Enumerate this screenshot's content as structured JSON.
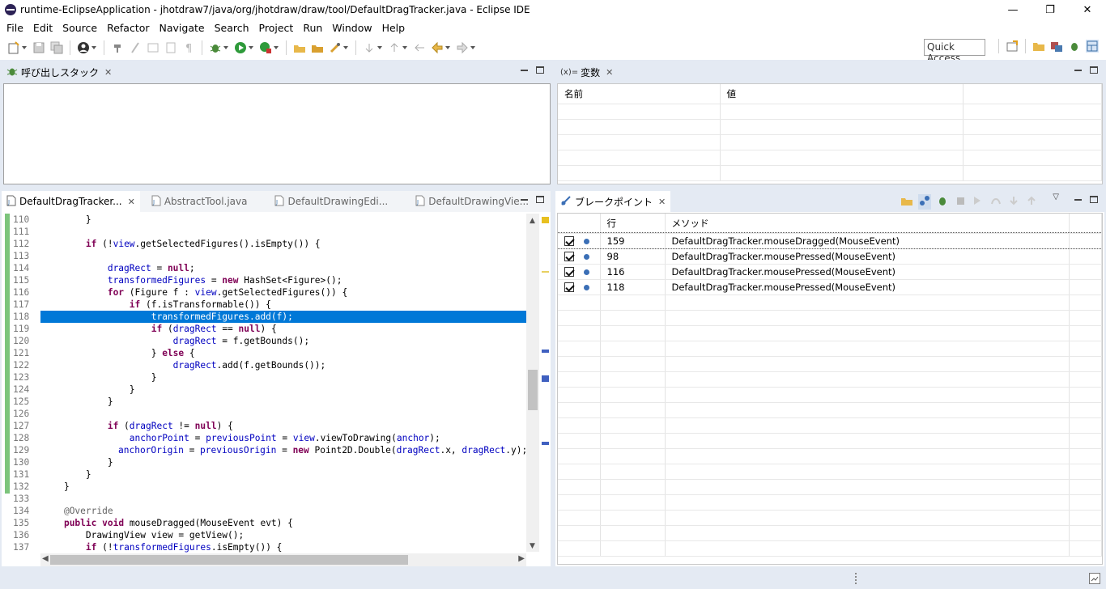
{
  "window": {
    "title": "runtime-EclipseApplication - jhotdraw7/java/org/jhotdraw/draw/tool/DefaultDragTracker.java - Eclipse IDE",
    "min_symbol": "—",
    "max_symbol": "❐",
    "close_symbol": "✕"
  },
  "menu": [
    "File",
    "Edit",
    "Source",
    "Refactor",
    "Navigate",
    "Search",
    "Project",
    "Run",
    "Window",
    "Help"
  ],
  "quick_access": "Quick Access",
  "callstack_view": {
    "title": "呼び出しスタック"
  },
  "variables_view": {
    "title": "変数",
    "icon_text": "(x)=",
    "columns": [
      "名前",
      "値",
      ""
    ]
  },
  "editor": {
    "tabs": [
      {
        "label": "DefaultDragTracker...",
        "active": true
      },
      {
        "label": "AbstractTool.java",
        "active": false
      },
      {
        "label": "DefaultDrawingEdi...",
        "active": false
      },
      {
        "label": "DefaultDrawingVie...",
        "active": false
      }
    ],
    "lines": [
      {
        "n": "110",
        "t": "        }"
      },
      {
        "n": "111",
        "t": ""
      },
      {
        "n": "112",
        "t": "        if (!view.getSelectedFigures().isEmpty()) {"
      },
      {
        "n": "113",
        "t": ""
      },
      {
        "n": "114",
        "t": "            dragRect = null;"
      },
      {
        "n": "115",
        "t": "            transformedFigures = new HashSet<Figure>();"
      },
      {
        "n": "116",
        "t": "            for (Figure f : view.getSelectedFigures()) {"
      },
      {
        "n": "117",
        "t": "                if (f.isTransformable()) {"
      },
      {
        "n": "118",
        "t": "                    transformedFigures.add(f);",
        "hl": true
      },
      {
        "n": "119",
        "t": "                    if (dragRect == null) {"
      },
      {
        "n": "120",
        "t": "                        dragRect = f.getBounds();"
      },
      {
        "n": "121",
        "t": "                    } else {"
      },
      {
        "n": "122",
        "t": "                        dragRect.add(f.getBounds());"
      },
      {
        "n": "123",
        "t": "                    }"
      },
      {
        "n": "124",
        "t": "                }"
      },
      {
        "n": "125",
        "t": "            }"
      },
      {
        "n": "126",
        "t": ""
      },
      {
        "n": "127",
        "t": "            if (dragRect != null) {"
      },
      {
        "n": "128",
        "t": "                anchorPoint = previousPoint = view.viewToDrawing(anchor);"
      },
      {
        "n": "129",
        "t": "                anchorOrigin = previousOrigin = new Point2D.Double(dragRect.x, dragRect.y);"
      },
      {
        "n": "130",
        "t": "            }"
      },
      {
        "n": "131",
        "t": "        }"
      },
      {
        "n": "132",
        "t": "    }"
      },
      {
        "n": "133",
        "t": ""
      },
      {
        "n": "134",
        "t": "    @Override"
      },
      {
        "n": "135",
        "t": "    public void mouseDragged(MouseEvent evt) {"
      },
      {
        "n": "136",
        "t": "        DrawingView view = getView();"
      },
      {
        "n": "137",
        "t": "        if (!transformedFigures.isEmpty()) {"
      }
    ]
  },
  "breakpoints_view": {
    "title": "ブレークポイント",
    "columns": [
      "",
      "行",
      "メソッド"
    ],
    "rows": [
      {
        "line": "159",
        "method": "DefaultDragTracker.mouseDragged(MouseEvent)",
        "checked": true
      },
      {
        "line": "98",
        "method": "DefaultDragTracker.mousePressed(MouseEvent)",
        "checked": true
      },
      {
        "line": "116",
        "method": "DefaultDragTracker.mousePressed(MouseEvent)",
        "checked": true
      },
      {
        "line": "118",
        "method": "DefaultDragTracker.mousePressed(MouseEvent)",
        "checked": true
      }
    ]
  },
  "colors": {
    "accent": "#0078d7",
    "keyword": "#7f0055",
    "field": "#0000c0",
    "gutter": "#7cc47c",
    "workbench": "#e4eaf3"
  }
}
